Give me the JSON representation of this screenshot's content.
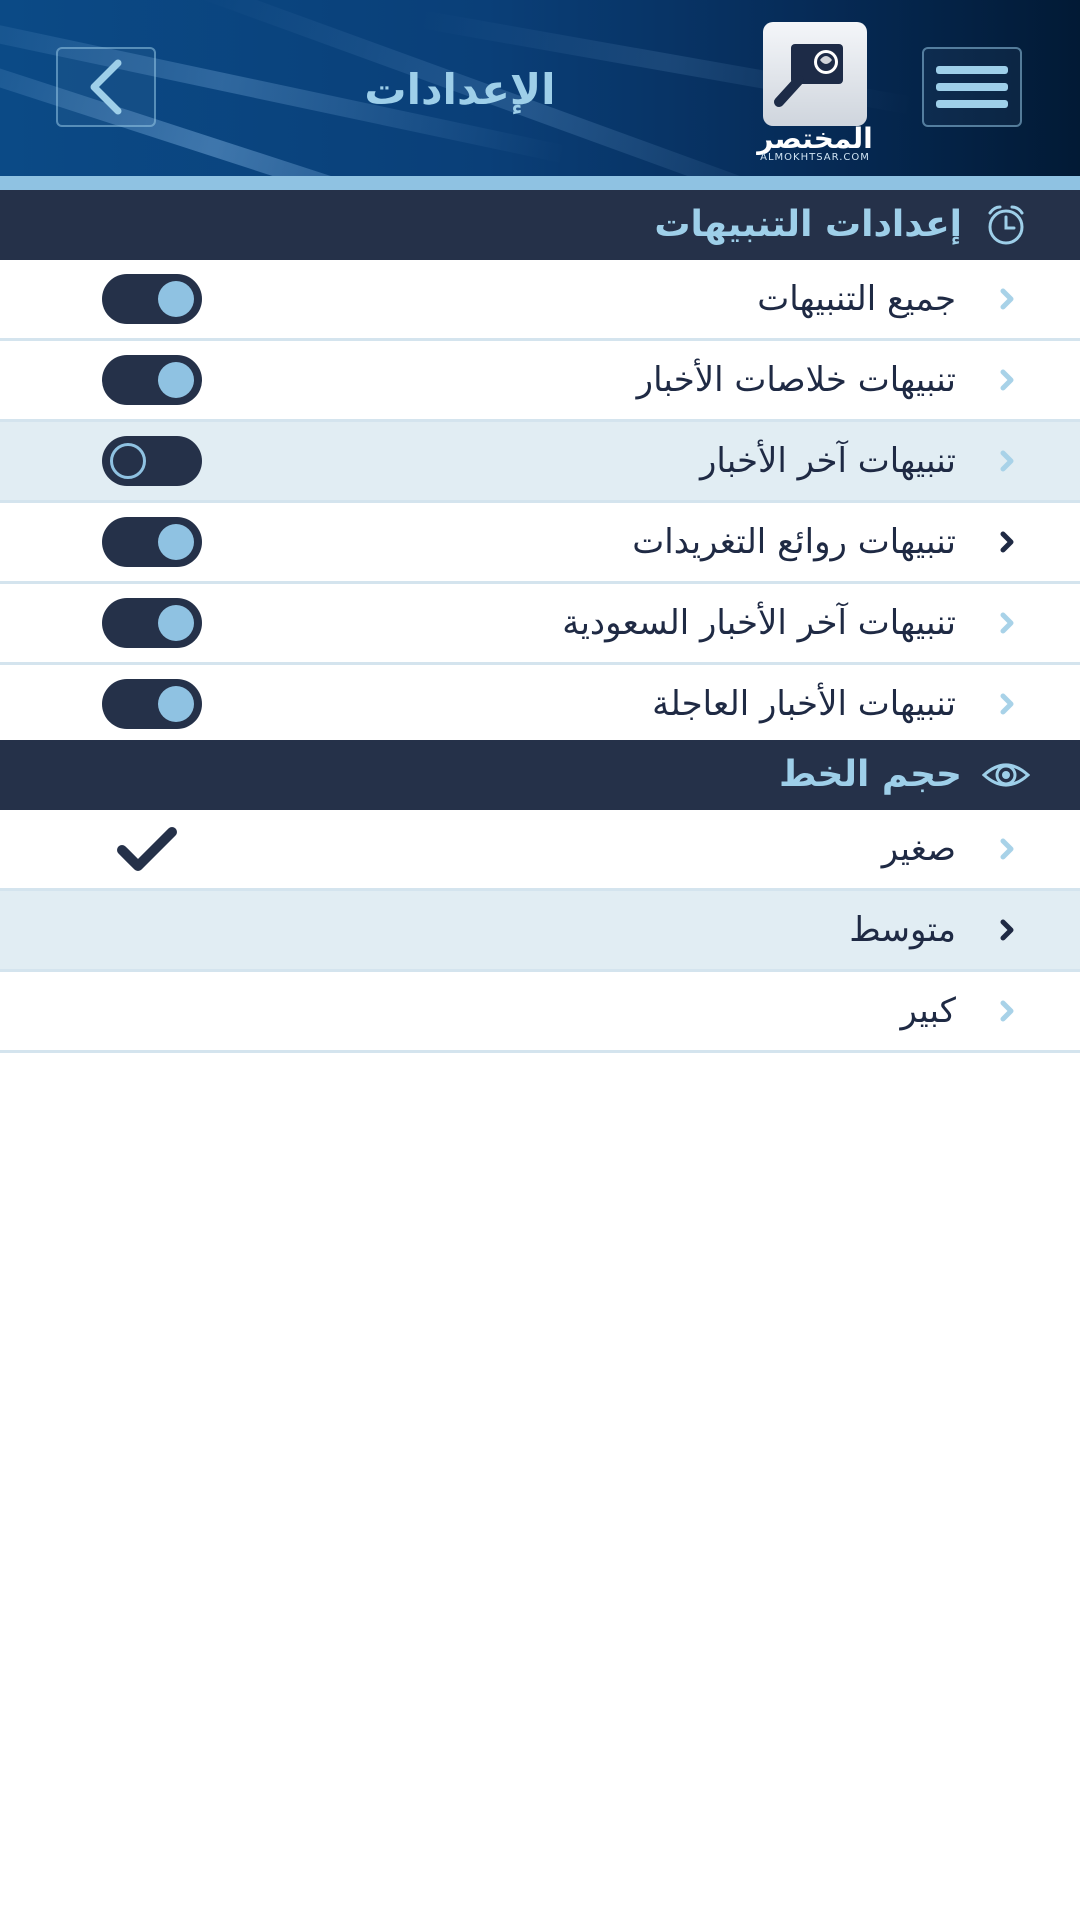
{
  "header": {
    "title": "الإعدادات",
    "logo_text": "المختصر",
    "logo_sub": "ALMOKHTSAR.COM",
    "back_icon": "chevron-left-icon",
    "menu_icon": "hamburger-menu-icon"
  },
  "alerts_section": {
    "title": "إعدادات التنبيهات",
    "icon": "alarm-clock-icon",
    "items": [
      {
        "label": "جميع التنبيهات",
        "enabled": true
      },
      {
        "label": "تنبيهات خلاصات الأخبار",
        "enabled": true
      },
      {
        "label": "تنبيهات آخر الأخبار",
        "enabled": false
      },
      {
        "label": "تنبيهات روائع التغريدات",
        "enabled": true
      },
      {
        "label": "تنبيهات آخر الأخبار السعودية",
        "enabled": true
      },
      {
        "label": "تنبيهات الأخبار العاجلة",
        "enabled": true
      }
    ]
  },
  "font_section": {
    "title": "حجم الخط",
    "icon": "eye-icon",
    "items": [
      {
        "label": "صغير",
        "selected": true
      },
      {
        "label": "متوسط",
        "selected": false
      },
      {
        "label": "كبير",
        "selected": false
      }
    ]
  },
  "colors": {
    "header_dark": "#253149",
    "accent_light_blue": "#8fc2e2",
    "row_highlight": "#e1edf3",
    "text_dark": "#1f2a44"
  }
}
